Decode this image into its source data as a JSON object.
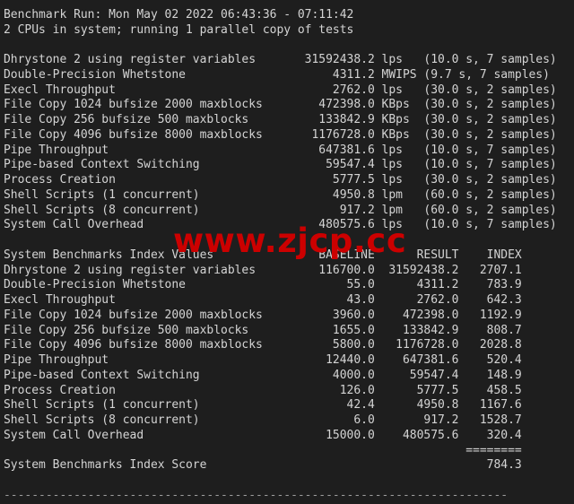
{
  "rule_top": "------------------------------------------------------------------------",
  "rule_bottom": "------------------------------------------------------------------------",
  "header": {
    "run_line": "Benchmark Run: Mon May 02 2022 06:43:36 - 07:11:42",
    "cpu_line": "2 CPUs in system; running 1 parallel copy of tests"
  },
  "results": [
    {
      "name": "Dhrystone 2 using register variables",
      "value": "31592438.2",
      "unit": "lps",
      "detail": "(10.0 s, 7 samples)"
    },
    {
      "name": "Double-Precision Whetstone",
      "value": "4311.2",
      "unit": "MWIPS",
      "detail": "(9.7 s, 7 samples)"
    },
    {
      "name": "Execl Throughput",
      "value": "2762.0",
      "unit": "lps",
      "detail": "(30.0 s, 2 samples)"
    },
    {
      "name": "File Copy 1024 bufsize 2000 maxblocks",
      "value": "472398.0",
      "unit": "KBps",
      "detail": "(30.0 s, 2 samples)"
    },
    {
      "name": "File Copy 256 bufsize 500 maxblocks",
      "value": "133842.9",
      "unit": "KBps",
      "detail": "(30.0 s, 2 samples)"
    },
    {
      "name": "File Copy 4096 bufsize 8000 maxblocks",
      "value": "1176728.0",
      "unit": "KBps",
      "detail": "(30.0 s, 2 samples)"
    },
    {
      "name": "Pipe Throughput",
      "value": "647381.6",
      "unit": "lps",
      "detail": "(10.0 s, 7 samples)"
    },
    {
      "name": "Pipe-based Context Switching",
      "value": "59547.4",
      "unit": "lps",
      "detail": "(10.0 s, 7 samples)"
    },
    {
      "name": "Process Creation",
      "value": "5777.5",
      "unit": "lps",
      "detail": "(30.0 s, 2 samples)"
    },
    {
      "name": "Shell Scripts (1 concurrent)",
      "value": "4950.8",
      "unit": "lpm",
      "detail": "(60.0 s, 2 samples)"
    },
    {
      "name": "Shell Scripts (8 concurrent)",
      "value": "917.2",
      "unit": "lpm",
      "detail": "(60.0 s, 2 samples)"
    },
    {
      "name": "System Call Overhead",
      "value": "480575.6",
      "unit": "lps",
      "detail": "(10.0 s, 7 samples)"
    }
  ],
  "index_table": {
    "title": "System Benchmarks Index Values",
    "col_baseline": "BASELINE",
    "col_result": "RESULT",
    "col_index": "INDEX",
    "rows": [
      {
        "name": "Dhrystone 2 using register variables",
        "baseline": "116700.0",
        "result": "31592438.2",
        "index": "2707.1"
      },
      {
        "name": "Double-Precision Whetstone",
        "baseline": "55.0",
        "result": "4311.2",
        "index": "783.9"
      },
      {
        "name": "Execl Throughput",
        "baseline": "43.0",
        "result": "2762.0",
        "index": "642.3"
      },
      {
        "name": "File Copy 1024 bufsize 2000 maxblocks",
        "baseline": "3960.0",
        "result": "472398.0",
        "index": "1192.9"
      },
      {
        "name": "File Copy 256 bufsize 500 maxblocks",
        "baseline": "1655.0",
        "result": "133842.9",
        "index": "808.7"
      },
      {
        "name": "File Copy 4096 bufsize 8000 maxblocks",
        "baseline": "5800.0",
        "result": "1176728.0",
        "index": "2028.8"
      },
      {
        "name": "Pipe Throughput",
        "baseline": "12440.0",
        "result": "647381.6",
        "index": "520.4"
      },
      {
        "name": "Pipe-based Context Switching",
        "baseline": "4000.0",
        "result": "59547.4",
        "index": "148.9"
      },
      {
        "name": "Process Creation",
        "baseline": "126.0",
        "result": "5777.5",
        "index": "458.5"
      },
      {
        "name": "Shell Scripts (1 concurrent)",
        "baseline": "42.4",
        "result": "4950.8",
        "index": "1167.6"
      },
      {
        "name": "Shell Scripts (8 concurrent)",
        "baseline": "6.0",
        "result": "917.2",
        "index": "1528.7"
      },
      {
        "name": "System Call Overhead",
        "baseline": "15000.0",
        "result": "480575.6",
        "index": "320.4"
      }
    ],
    "separator": "========",
    "score_label": "System Benchmarks Index Score",
    "score_value": "784.3"
  },
  "watermark": "www.zjcp.cc",
  "colors": {
    "background": "#1e1e1e",
    "text": "#d4d4d4",
    "watermark": "#cc0000"
  }
}
